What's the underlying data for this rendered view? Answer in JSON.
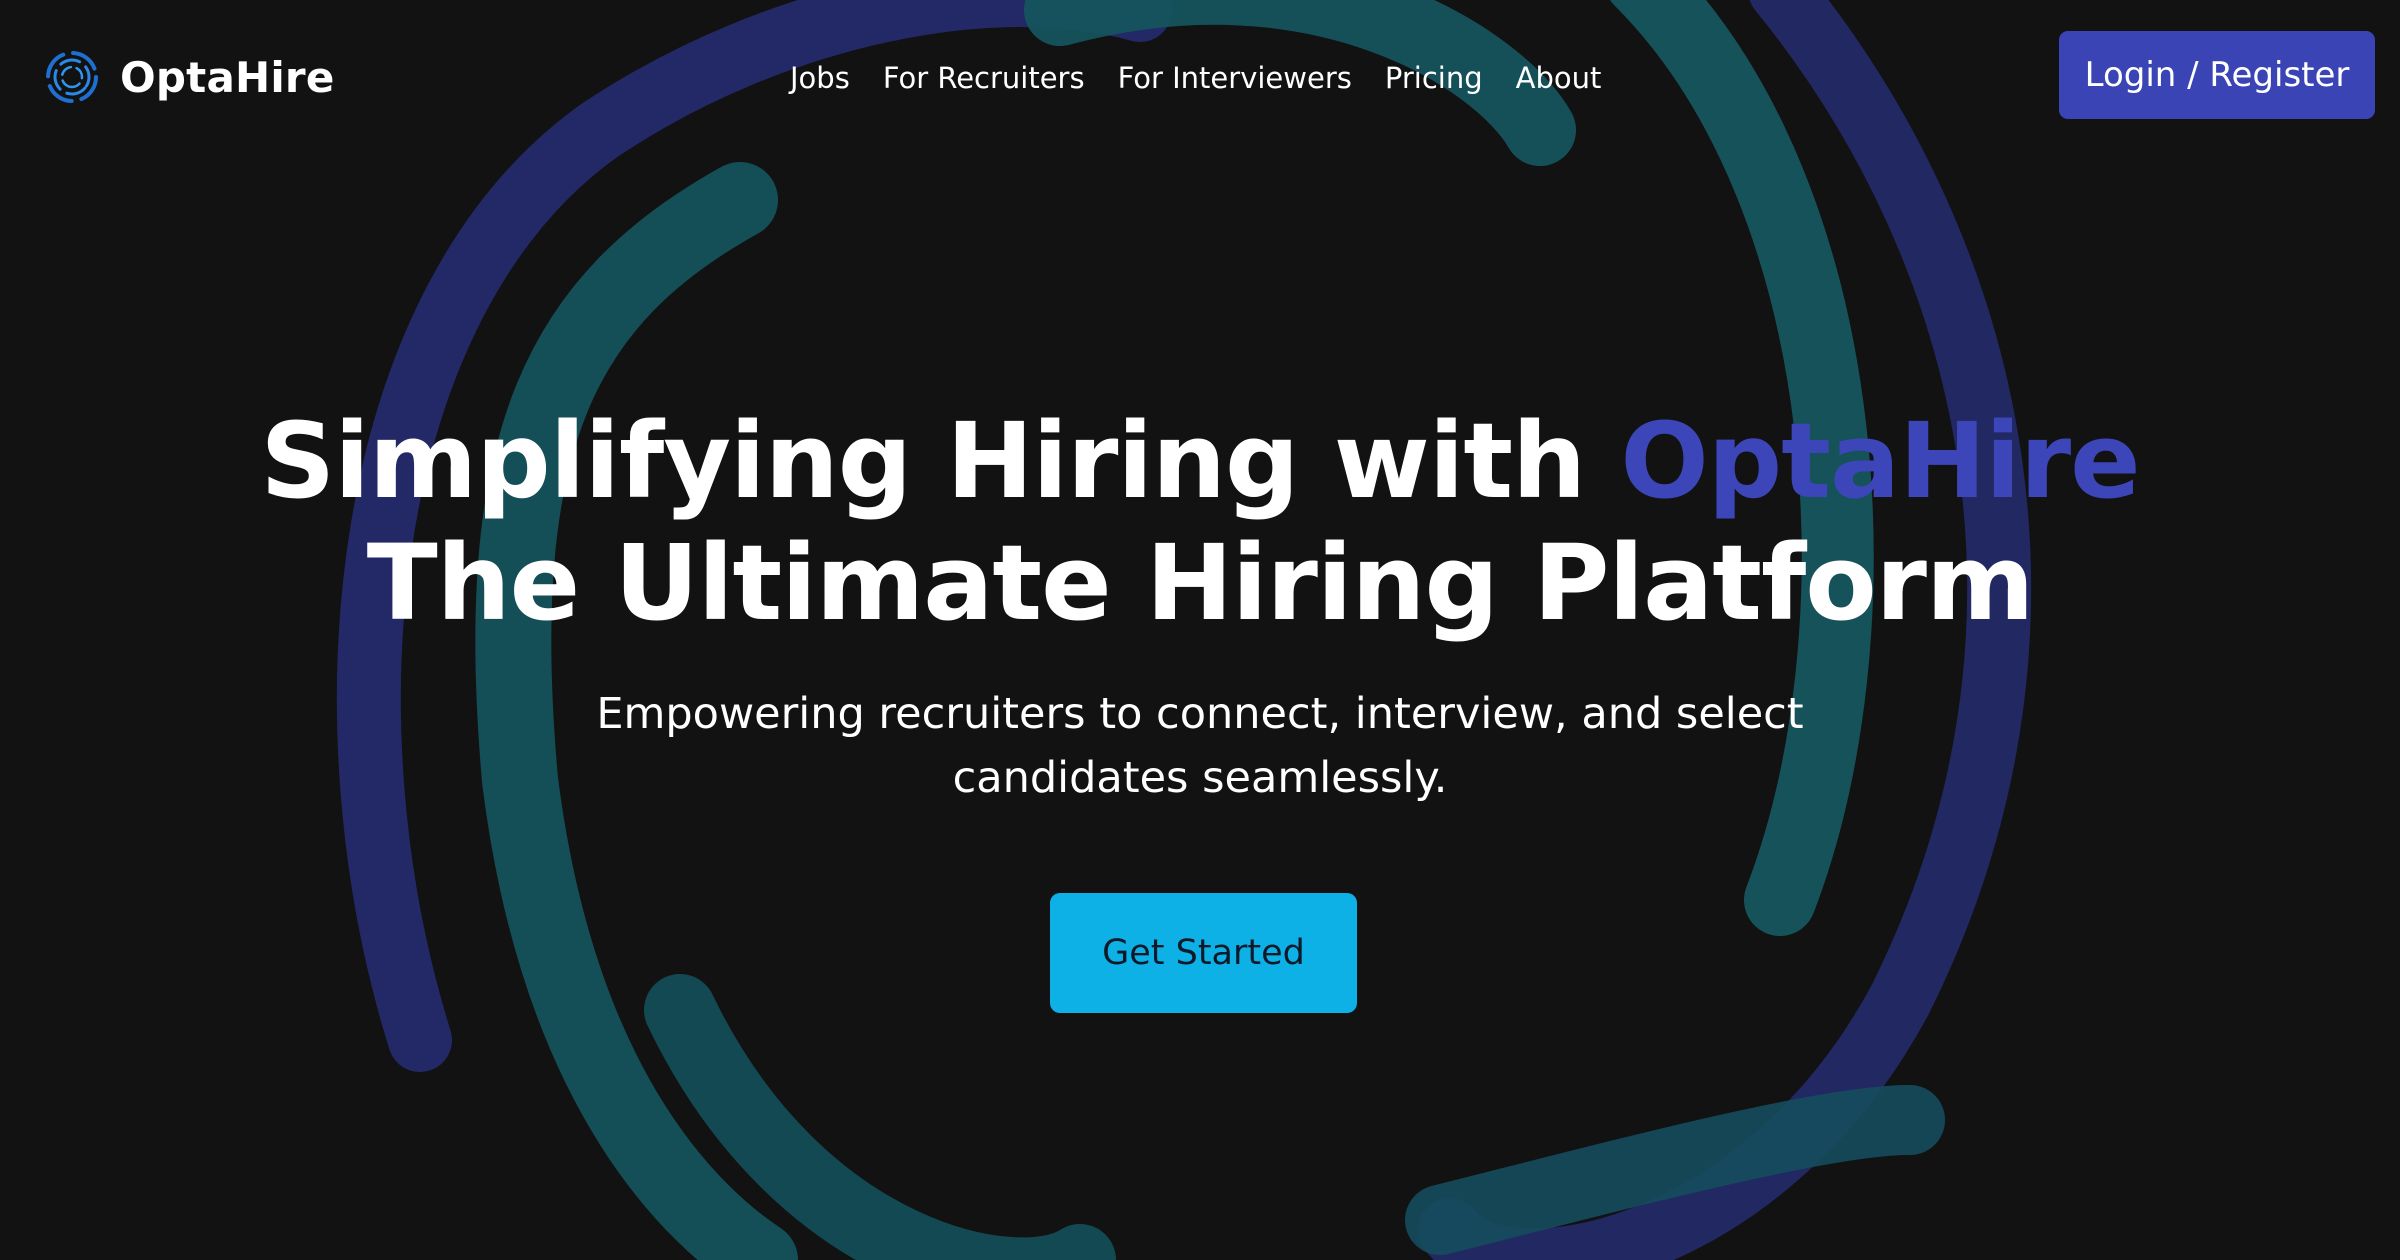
{
  "header": {
    "brand_name": "OptaHire",
    "logo_icon": "spiral-logo-icon",
    "nav": [
      {
        "label": "Jobs"
      },
      {
        "label": "For Recruiters"
      },
      {
        "label": "For Interviewers"
      },
      {
        "label": "Pricing"
      },
      {
        "label": "About"
      }
    ],
    "login_label": "Login / Register"
  },
  "hero": {
    "title_line1_prefix": "Simplifying Hiring with ",
    "title_line1_accent": "OptaHire",
    "title_line2": "The Ultimate Hiring Platform",
    "subtitle_line1": "Empowering recruiters to connect, interview, and select",
    "subtitle_line2": "candidates seamlessly.",
    "cta_label": "Get Started"
  },
  "colors": {
    "background": "#121212",
    "accent_indigo": "#3a44b5",
    "accent_cyan": "#0db1e6",
    "ring_teal": "#16555f",
    "ring_indigo": "#252c6e"
  }
}
